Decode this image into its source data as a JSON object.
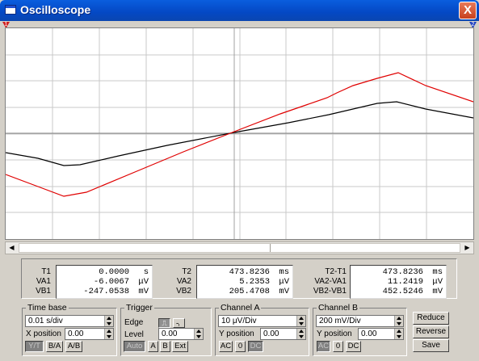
{
  "window": {
    "title": "Oscilloscope",
    "close_label": "X"
  },
  "markers": {
    "cursor1": "1",
    "cursor2": "2"
  },
  "colors": {
    "channel_a": "#e00000",
    "channel_b": "#000000",
    "grid": "#c8c8c8",
    "title_bar": "#0a5ede"
  },
  "readout": {
    "t1": {
      "labels": [
        "T1",
        "VA1",
        "VB1"
      ],
      "values": [
        "0.0000",
        "-6.0067",
        "-247.0538"
      ],
      "units": [
        "s",
        "μV",
        "mV"
      ]
    },
    "t2": {
      "labels": [
        "T2",
        "VA2",
        "VB2"
      ],
      "values": [
        "473.8236",
        "5.2353",
        "205.4708"
      ],
      "units": [
        "ms",
        "μV",
        "mV"
      ]
    },
    "diff": {
      "labels": [
        "T2-T1",
        "VA2-VA1",
        "VB2-VB1"
      ],
      "values": [
        "473.8236",
        "11.2419",
        "452.5246"
      ],
      "units": [
        "ms",
        "μV",
        "mV"
      ]
    }
  },
  "timebase": {
    "title": "Time base",
    "scale": "0.01 s/div",
    "xpos_label": "X position",
    "xpos_value": "0.00",
    "modes": [
      "Y/T",
      "B/A",
      "A/B"
    ],
    "active_mode": "Y/T"
  },
  "trigger": {
    "title": "Trigger",
    "edge_label": "Edge",
    "edge_rising_icon": "rising-edge-icon",
    "edge_falling_icon": "falling-edge-icon",
    "level_label": "Level",
    "level_value": "0.00",
    "sources": [
      "Auto",
      "A",
      "B",
      "Ext"
    ],
    "active_source": "Auto"
  },
  "channel_a": {
    "title": "Channel A",
    "scale": "10 μV/Div",
    "ypos_label": "Y position",
    "ypos_value": "0.00",
    "coupling": [
      "AC",
      "0",
      "DC"
    ],
    "active_coupling": "DC"
  },
  "channel_b": {
    "title": "Channel B",
    "scale": "200 mV/Div",
    "ypos_label": "Y position",
    "ypos_value": "0.00",
    "coupling": [
      "AC",
      "0",
      "DC"
    ],
    "active_coupling": "AC"
  },
  "actions": {
    "reduce": "Reduce",
    "reverse": "Reverse",
    "save": "Save"
  }
}
